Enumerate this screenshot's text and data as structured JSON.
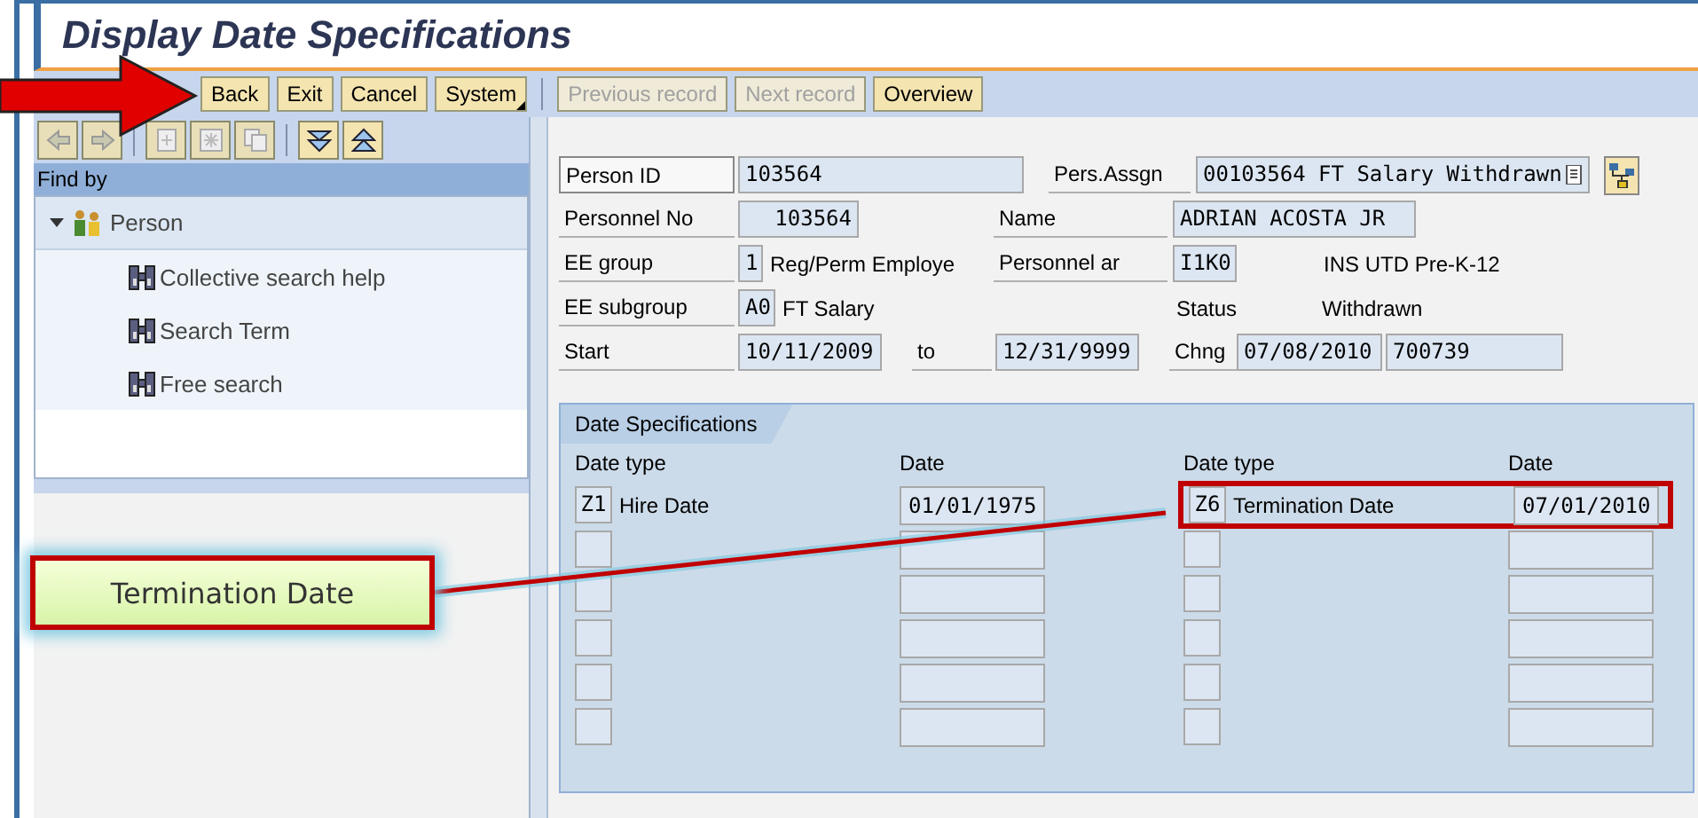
{
  "title": "Display Date Specifications",
  "toolbar": [
    {
      "label": "Back",
      "disabled": false,
      "menu": false
    },
    {
      "label": "Exit",
      "disabled": false,
      "menu": false
    },
    {
      "label": "Cancel",
      "disabled": false,
      "menu": false
    },
    {
      "label": "System",
      "disabled": false,
      "menu": true
    },
    {
      "label": "Previous record",
      "disabled": true,
      "menu": false
    },
    {
      "label": "Next record",
      "disabled": true,
      "menu": false
    },
    {
      "label": "Overview",
      "disabled": false,
      "menu": false
    }
  ],
  "nav_buttons": [
    {
      "kind": "left",
      "disabled": true
    },
    {
      "kind": "right",
      "disabled": true
    },
    {
      "kind": "new",
      "disabled": true
    },
    {
      "kind": "star",
      "disabled": true
    },
    {
      "kind": "copy",
      "disabled": true
    },
    {
      "kind": "down",
      "disabled": false
    },
    {
      "kind": "up",
      "disabled": false
    }
  ],
  "find_by": "Find by",
  "tree": [
    {
      "label": "Person",
      "expanded": true,
      "children": [
        {
          "label": "Collective search help"
        },
        {
          "label": "Search Term"
        },
        {
          "label": "Free search"
        }
      ]
    }
  ],
  "header": {
    "person_id": {
      "label": "Person ID",
      "value": "103564"
    },
    "pers_assgn": {
      "label": "Pers.Assgn",
      "value": "00103564 FT Salary Withdrawn"
    },
    "personnel_no": {
      "label": "Personnel No",
      "value": "103564"
    },
    "name": {
      "label": "Name",
      "value": "ADRIAN ACOSTA JR"
    },
    "ee_group": {
      "label": "EE group",
      "value": "1",
      "text": "Reg/Perm Employe"
    },
    "personnel_area": {
      "label": "Personnel ar",
      "value": "I1K0",
      "text": "INS UTD Pre-K-12"
    },
    "ee_subgroup": {
      "label": "EE subgroup",
      "value": "A0",
      "text": "FT Salary"
    },
    "status": {
      "label": "Status",
      "text": "Withdrawn"
    },
    "start": {
      "label": "Start",
      "value": "10/11/2009"
    },
    "to": {
      "label": "to",
      "value": "12/31/9999"
    },
    "chng": {
      "label": "Chng",
      "date": "07/08/2010",
      "user": "700739"
    }
  },
  "date_specifications": {
    "title": "Date Specifications",
    "columns": [
      "Date type",
      "Date",
      "Date type",
      "Date"
    ],
    "left": [
      {
        "kind": "filled",
        "code": "Z1",
        "text": "Hire Date",
        "date": "01/01/1975"
      },
      {
        "kind": "empty"
      },
      {
        "kind": "empty"
      },
      {
        "kind": "empty"
      },
      {
        "kind": "empty"
      },
      {
        "kind": "empty"
      }
    ],
    "right": [
      {
        "code": "Z6",
        "text": "Termination Date",
        "date": "07/01/2010",
        "highlighted": true
      },
      {
        "highlighted": false
      },
      {
        "highlighted": false
      },
      {
        "highlighted": false
      },
      {
        "highlighted": false
      },
      {
        "highlighted": false
      }
    ]
  },
  "callout": "Termination Date"
}
